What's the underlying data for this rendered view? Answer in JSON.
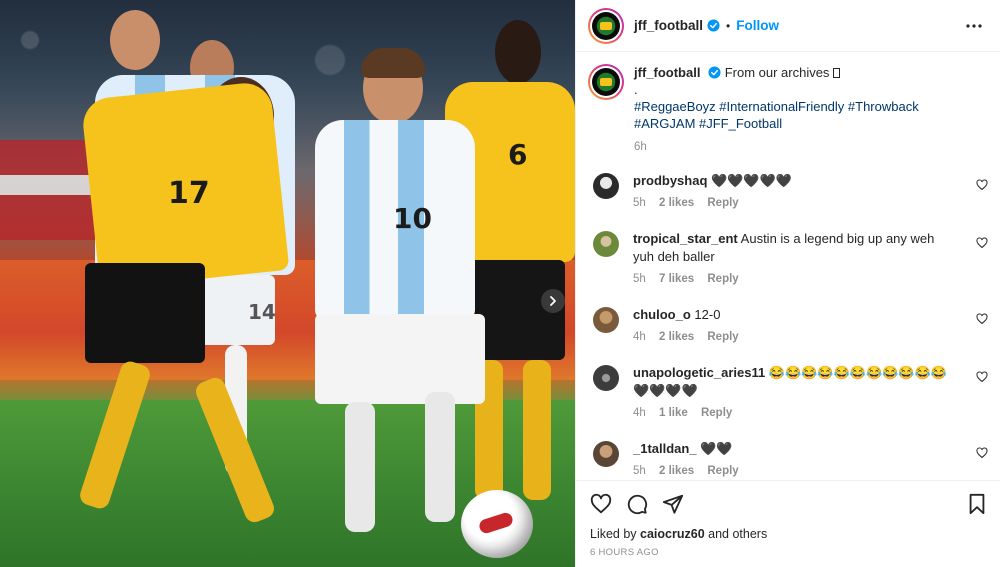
{
  "post": {
    "username": "jff_football",
    "follow_label": "Follow",
    "separator": "•",
    "caption_user": "jff_football",
    "caption_text": "From our archives ",
    "caption_dot": ".",
    "hashtags": "#ReggaeBoyz #InternationalFriendly #Throwback #ARGJAM #JFF_Football",
    "caption_time": "6h",
    "jersey_numbers": [
      "17",
      "10",
      "6",
      "14"
    ]
  },
  "comments": [
    {
      "user": "prodbyshaq",
      "text": "🖤🖤🖤🖤🖤",
      "time": "5h",
      "likes": "2 likes",
      "reply": "Reply",
      "avatar_color": "#2b2b2b"
    },
    {
      "user": "tropical_star_ent",
      "text": "Austin is a legend big up any weh yuh deh baller",
      "time": "5h",
      "likes": "7 likes",
      "reply": "Reply",
      "avatar_color": "#6d8a3a"
    },
    {
      "user": "chuloo_o",
      "text": "12-0",
      "time": "4h",
      "likes": "2 likes",
      "reply": "Reply",
      "avatar_color": "#7a5a3a"
    },
    {
      "user": "unapologetic_aries11",
      "text": "😂😂😂😂😂😂😂😂😂😂😂🖤🖤🖤🖤",
      "time": "4h",
      "likes": "1 like",
      "reply": "Reply",
      "avatar_color": "#3c3c3c"
    },
    {
      "user": "_1talldan_",
      "text": "🖤🖤",
      "time": "5h",
      "likes": "2 likes",
      "reply": "Reply",
      "avatar_color": "#5a4636"
    }
  ],
  "footer": {
    "liked_prefix": "Liked by ",
    "liked_user": "caiocruz60",
    "liked_suffix": " and others",
    "time_ago": "6 HOURS AGO"
  },
  "icons": {
    "verified": "verified-badge-icon",
    "more": "more-options-icon",
    "heart": "heart-icon",
    "comment": "comment-icon",
    "share": "share-icon",
    "save": "bookmark-icon",
    "next": "chevron-right-icon"
  },
  "colors": {
    "accent": "#0095f6",
    "hashtag": "#00376b",
    "muted": "#8e8e8e",
    "jamaica_yellow": "#f6c21c",
    "argentina_blue": "#8fc3e8"
  }
}
